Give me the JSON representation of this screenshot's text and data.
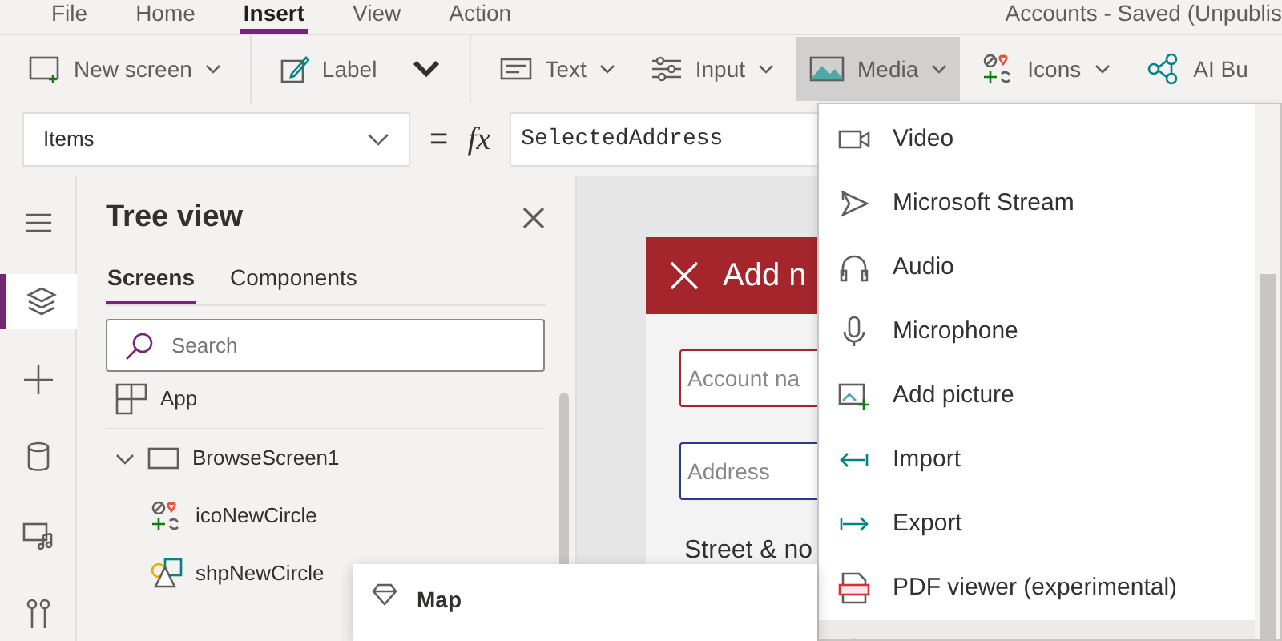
{
  "menu_tabs": [
    {
      "label": "File",
      "selected": false
    },
    {
      "label": "Home",
      "selected": false
    },
    {
      "label": "Insert",
      "selected": true
    },
    {
      "label": "View",
      "selected": false
    },
    {
      "label": "Action",
      "selected": false
    }
  ],
  "document_title": "Accounts - Saved (Unpublis",
  "ribbon": [
    {
      "kind": "dropdown",
      "label": "New screen",
      "pressed": false
    },
    {
      "kind": "divider"
    },
    {
      "kind": "button",
      "label": "Label",
      "pressed": false
    },
    {
      "kind": "expand",
      "pressed": false
    },
    {
      "kind": "divider"
    },
    {
      "kind": "dropdown",
      "label": "Text",
      "pressed": false
    },
    {
      "kind": "dropdown",
      "label": "Input",
      "pressed": false
    },
    {
      "kind": "dropdown",
      "label": "Media",
      "pressed": true
    },
    {
      "kind": "dropdown",
      "label": "Icons",
      "pressed": false
    },
    {
      "kind": "button",
      "label": "AI Bu",
      "pressed": false
    }
  ],
  "formula_bar": {
    "property": "Items",
    "equals": "=",
    "fx": "fx",
    "formula": "SelectedAddress"
  },
  "rail": [
    {
      "selected": false
    },
    {
      "selected": true
    },
    {
      "selected": false
    },
    {
      "selected": false
    },
    {
      "selected": false
    },
    {
      "selected": false
    }
  ],
  "tree_view": {
    "title": "Tree view",
    "tabs": [
      {
        "label": "Screens",
        "selected": true
      },
      {
        "label": "Components",
        "selected": false
      }
    ],
    "search_placeholder": "Search",
    "items": [
      {
        "label": "App"
      },
      {
        "label": "BrowseScreen1",
        "expanded": true,
        "children": [
          {
            "label": "icoNewCircle"
          },
          {
            "label": "shpNewCircle"
          }
        ]
      }
    ]
  },
  "canvas": {
    "header": "Add n",
    "fields": [
      {
        "placeholder": "Account na",
        "kind": "error"
      },
      {
        "placeholder": "Address",
        "kind": "focused"
      }
    ],
    "label": "Street & no"
  },
  "media_menu": {
    "items": [
      {
        "label": "Video",
        "selected": false
      },
      {
        "label": "Microsoft Stream",
        "selected": false
      },
      {
        "label": "Audio",
        "selected": false
      },
      {
        "label": "Microphone",
        "selected": false
      },
      {
        "label": "Add picture",
        "selected": false
      },
      {
        "label": "Import",
        "selected": false
      },
      {
        "label": "Export",
        "selected": false
      },
      {
        "label": "PDF viewer (experimental)",
        "selected": false
      },
      {
        "selected": true
      }
    ]
  },
  "tooltip": {
    "title": "Map"
  }
}
